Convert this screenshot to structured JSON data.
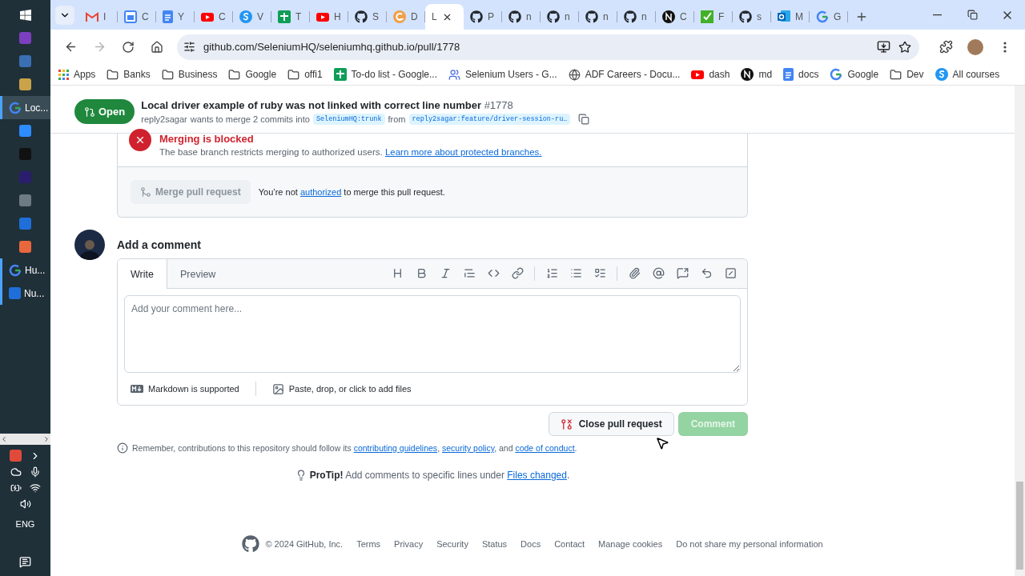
{
  "taskbar": {
    "windows": [
      {
        "label": "Loc...",
        "selected": true
      },
      {
        "label": "Hu...",
        "selected": false
      },
      {
        "label": "Nu...",
        "selected": false
      }
    ],
    "language": "ENG"
  },
  "browser": {
    "tabs": [
      {
        "kind": "gmail",
        "title": "I",
        "selected": false
      },
      {
        "kind": "calendar",
        "title": "C",
        "selected": false
      },
      {
        "kind": "docs",
        "title": "Y",
        "selected": false
      },
      {
        "kind": "youtube",
        "title": "C",
        "selected": false
      },
      {
        "kind": "skype",
        "title": "V",
        "selected": false
      },
      {
        "kind": "sheets",
        "title": "T",
        "selected": false
      },
      {
        "kind": "youtube",
        "title": "H",
        "selected": false
      },
      {
        "kind": "github",
        "title": "S",
        "selected": false
      },
      {
        "kind": "orange",
        "title": "D",
        "selected": false
      },
      {
        "kind": "none",
        "title": "L",
        "selected": true
      },
      {
        "kind": "github",
        "title": "P",
        "selected": false
      },
      {
        "kind": "github",
        "title": "n",
        "selected": false
      },
      {
        "kind": "github",
        "title": "n",
        "selected": false
      },
      {
        "kind": "github",
        "title": "n",
        "selected": false
      },
      {
        "kind": "github",
        "title": "n",
        "selected": false
      },
      {
        "kind": "dark",
        "title": "C",
        "selected": false
      },
      {
        "kind": "selenium",
        "title": "F",
        "selected": false
      },
      {
        "kind": "github",
        "title": "s",
        "selected": false
      },
      {
        "kind": "outlook",
        "title": "M",
        "selected": false
      },
      {
        "kind": "google",
        "title": "G",
        "selected": false
      }
    ],
    "address": "github.com/SeleniumHQ/seleniumhq.github.io/pull/1778",
    "bookmarks": [
      {
        "kind": "apps",
        "label": "Apps"
      },
      {
        "kind": "folder",
        "label": "Banks"
      },
      {
        "kind": "folder",
        "label": "Business"
      },
      {
        "kind": "folder",
        "label": "Google"
      },
      {
        "kind": "folder",
        "label": "offi1"
      },
      {
        "kind": "sheets",
        "label": "To-do list - Google..."
      },
      {
        "kind": "people",
        "label": "Selenium Users - G..."
      },
      {
        "kind": "globe",
        "label": "ADF Careers - Docu..."
      },
      {
        "kind": "youtube",
        "label": "dash"
      },
      {
        "kind": "dark",
        "label": "md"
      },
      {
        "kind": "docs",
        "label": "docs"
      },
      {
        "kind": "google",
        "label": "Google"
      },
      {
        "kind": "folder",
        "label": "Dev"
      },
      {
        "kind": "skype",
        "label": "All courses"
      }
    ]
  },
  "pr_header": {
    "state": "Open",
    "title": "Local driver example of ruby was not linked with correct line number",
    "number": "#1778",
    "author": "reply2sagar",
    "summary": "wants to merge 2 commits into",
    "base": "SeleniumHQ:trunk",
    "from": "from",
    "head": "reply2sagar:feature/driver-session-ru…"
  },
  "merge_box": {
    "status": "Merging is blocked",
    "message": "The base branch restricts merging to authorized users.",
    "link": "Learn more about protected branches.",
    "merge_button": {
      "label": "Merge pull request",
      "disabled": true
    },
    "note": [
      {
        "kind": "text",
        "text": "You’re not "
      },
      {
        "kind": "link",
        "text": "authorized"
      },
      {
        "kind": "text",
        "text": " to merge this pull request."
      }
    ]
  },
  "comment": {
    "heading": "Add a comment",
    "tabs": [
      {
        "label": "Write",
        "selected": true
      },
      {
        "label": "Preview",
        "selected": false
      }
    ],
    "placeholder": "Add your comment here...",
    "markdown_note": "Markdown is supported",
    "attach_note": "Paste, drop, or click to add files",
    "close_button": "Close pull request",
    "comment_button": {
      "label": "Comment",
      "disabled": true
    }
  },
  "guidelines": [
    {
      "kind": "text",
      "text": "Remember, contributions to this repository should follow its "
    },
    {
      "kind": "link",
      "text": "contributing guidelines"
    },
    {
      "kind": "text",
      "text": ", "
    },
    {
      "kind": "link",
      "text": "security policy"
    },
    {
      "kind": "text",
      "text": ", and "
    },
    {
      "kind": "link",
      "text": "code of conduct"
    },
    {
      "kind": "text",
      "text": "."
    }
  ],
  "protip": {
    "label": "ProTip!",
    "parts": [
      {
        "kind": "text",
        "text": " Add comments to specific lines under "
      },
      {
        "kind": "link",
        "text": "Files changed"
      },
      {
        "kind": "text",
        "text": "."
      }
    ]
  },
  "footer": {
    "copyright": "© 2024 GitHub, Inc.",
    "links": [
      "Terms",
      "Privacy",
      "Security",
      "Status",
      "Docs",
      "Contact",
      "Manage cookies",
      "Do not share my personal information"
    ]
  }
}
